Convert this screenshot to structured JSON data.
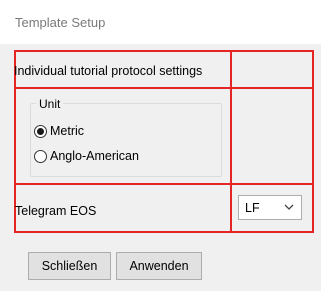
{
  "window": {
    "title": "Template Setup"
  },
  "section1": {
    "label": "Individual tutorial protocol settings"
  },
  "unit": {
    "legend": "Unit",
    "options": [
      {
        "label": "Metric",
        "checked": true
      },
      {
        "label": "Anglo-American",
        "checked": false
      }
    ]
  },
  "telegram": {
    "label": "Telegram EOS",
    "selected": "LF"
  },
  "buttons": {
    "close": "Schließen",
    "apply": "Anwenden"
  },
  "colors": {
    "highlight": "#e52424"
  }
}
